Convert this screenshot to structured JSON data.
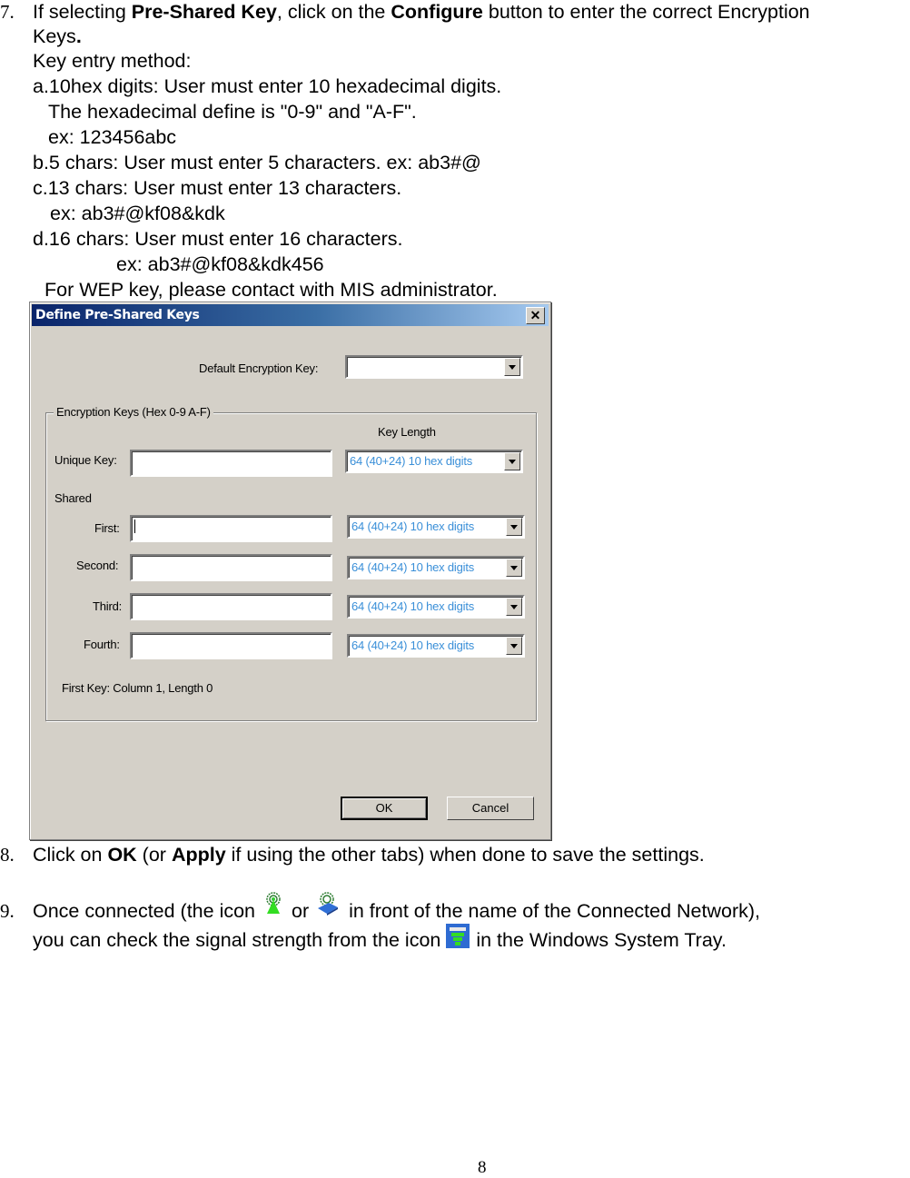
{
  "step7": {
    "number": "7.",
    "line1_pre": "If selecting ",
    "line1_bold1": "Pre-Shared Key",
    "line1_mid": ", click on the ",
    "line1_bold2": "Configure",
    "line1_post": " button to enter the correct Encryption",
    "line2": "Keys",
    "line2_bold": ".",
    "key_entry_method": "Key entry method:",
    "a_line1": "a.10hex digits: User must enter 10 hexadecimal digits.",
    "a_line2": "The hexadecimal define is \"0-9\" and \"A-F\".",
    "a_line3": "ex: 123456abc",
    "b_line1": "b.5 chars: User must enter 5 characters. ex: ab3#@",
    "c_line1": "c.13 chars: User must enter 13 characters.",
    "c_line2": "ex: ab3#@kf08&kdk",
    "d_line1": "d.16 chars: User must enter 16 characters.",
    "d_line2": "ex: ab3#@kf08&kdk456",
    "wep_note": "For WEP key, please contact with MIS administrator."
  },
  "dialog": {
    "title": "Define Pre-Shared Keys",
    "close_glyph": "✕",
    "default_key_label": "Default Encryption Key:",
    "default_key_value": "",
    "group_label": "Encryption Keys (Hex 0-9 A-F)",
    "key_length_header": "Key Length",
    "unique_key_label": "Unique Key:",
    "shared_label": "Shared",
    "keys": [
      {
        "label": "Unique Key:",
        "value": "",
        "length": "64  (40+24)  10 hex digits"
      },
      {
        "label": "First:",
        "value": "",
        "length": "64  (40+24)  10 hex digits"
      },
      {
        "label": "Second:",
        "value": "",
        "length": "64  (40+24)  10 hex digits"
      },
      {
        "label": "Third:",
        "value": "",
        "length": "64  (40+24)  10 hex digits"
      },
      {
        "label": "Fourth:",
        "value": "",
        "length": "64  (40+24)  10 hex digits"
      }
    ],
    "status": "First Key: Column 1,  Length 0",
    "ok_label": "OK",
    "cancel_label": "Cancel"
  },
  "step8": {
    "number": "8.",
    "pre": "Click on ",
    "bold1": "OK",
    "mid": " (or ",
    "bold2": "Apply",
    "post": " if using the other tabs) when done to save the settings."
  },
  "step9": {
    "number": "9.",
    "line1_pre": "Once connected (the icon ",
    "line1_or": "or ",
    "line1_post": " in front of the name of the Connected Network),",
    "line2_pre": "you can check the signal strength from the icon ",
    "line2_post": " in the Windows System Tray.",
    "icons": [
      "antenna-connected-icon",
      "network-connected-icon",
      "signal-strength-icon"
    ]
  },
  "page_number": "8"
}
